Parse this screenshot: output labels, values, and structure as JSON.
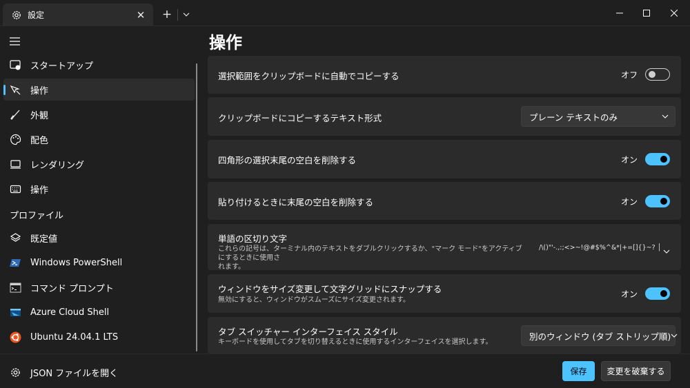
{
  "window": {
    "tab_title": "設定",
    "tab_close": "✕",
    "new_tab": "+"
  },
  "sidebar": {
    "items": [
      {
        "label": "スタートアップ",
        "icon": "startup-icon"
      },
      {
        "label": "操作",
        "icon": "interaction-icon",
        "selected": true
      },
      {
        "label": "外観",
        "icon": "brush-icon"
      },
      {
        "label": "配色",
        "icon": "palette-icon"
      },
      {
        "label": "レンダリング",
        "icon": "monitor-icon"
      },
      {
        "label": "操作",
        "icon": "keyboard-icon"
      }
    ],
    "profiles_header": "プロファイル",
    "profiles": [
      {
        "label": "既定値",
        "icon": "layers-icon"
      },
      {
        "label": "Windows PowerShell",
        "icon": "powershell-icon"
      },
      {
        "label": "コマンド プロンプト",
        "icon": "cmd-icon"
      },
      {
        "label": "Azure Cloud Shell",
        "icon": "azure-icon"
      },
      {
        "label": "Ubuntu 24.04.1 LTS",
        "icon": "ubuntu-icon"
      }
    ],
    "open_json": "JSON ファイルを開く"
  },
  "main": {
    "title": "操作",
    "settings": {
      "copy_on_select": {
        "title": "選択範囲をクリップボードに自動でコピーする",
        "state": "オフ",
        "on": false
      },
      "copy_format": {
        "title": "クリップボードにコピーするテキスト形式",
        "value": "プレーン テキストのみ"
      },
      "trim_block": {
        "title": "四角形の選択末尾の空白を削除する",
        "state": "オン",
        "on": true
      },
      "trim_paste": {
        "title": "貼り付けるときに末尾の空白を削除する",
        "state": "オン",
        "on": true
      },
      "word_delimiters": {
        "title": "単語の区切り文字",
        "desc_line1": "これらの記号は、ターミナル内のテキストをダブルクリックするか、\"マーク モード\"をアクティブにするときに使用さ",
        "desc_line2": "れます。",
        "value": "/\\()\"'-.,:;<>~!@#$%^&*|+=[]{}~? │"
      },
      "snap_resize": {
        "title": "ウィンドウをサイズ変更して文字グリッドにスナップする",
        "desc": "無効にすると、ウィンドウがスムーズにサイズ変更されます。",
        "state": "オン",
        "on": true
      },
      "tab_switcher": {
        "title": "タブ スイッチャー インターフェイス スタイル",
        "desc": "キーボードを使用してタブを切り替えるときに使用するインターフェイスを選択します。",
        "value": "別のウィンドウ (タブ ストリップ順)"
      }
    }
  },
  "footer": {
    "save": "保存",
    "discard": "変更を破棄する"
  },
  "colors": {
    "accent": "#4cc2ff",
    "background": "#1f1f1f",
    "card": "#2b2b2b"
  }
}
